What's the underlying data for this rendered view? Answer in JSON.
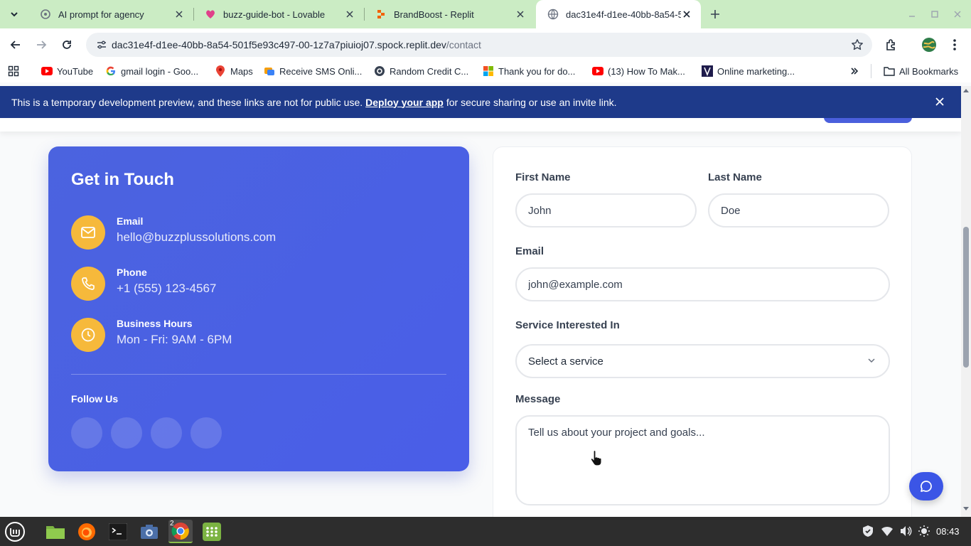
{
  "browser": {
    "tabs": [
      {
        "title": "AI prompt for agency",
        "icon": "openai-icon"
      },
      {
        "title": "buzz-guide-bot - Lovable",
        "icon": "lovable-heart-icon"
      },
      {
        "title": "BrandBoost - Replit",
        "icon": "replit-icon"
      },
      {
        "title": "dac31e4f-d1ee-40bb-8a54-5",
        "icon": "globe-icon",
        "active": true
      }
    ],
    "url_host": "dac31e4f-d1ee-40bb-8a54-501f5e93c497-00-1z7a7piuioj07.spock.replit.dev",
    "url_path": "/contact",
    "bookmarks": [
      {
        "label": "YouTube",
        "icon": "youtube-icon"
      },
      {
        "label": "gmail login - Goo...",
        "icon": "google-icon"
      },
      {
        "label": "Maps",
        "icon": "maps-icon"
      },
      {
        "label": "Receive SMS Onli...",
        "icon": "sms-icon"
      },
      {
        "label": "Random Credit C...",
        "icon": "gear-icon"
      },
      {
        "label": "Thank you for do...",
        "icon": "microsoft-icon"
      },
      {
        "label": "(13) How To Mak...",
        "icon": "youtube-icon"
      },
      {
        "label": "Online marketing...",
        "icon": "vercel-icon"
      }
    ],
    "all_bookmarks": "All Bookmarks"
  },
  "banner": {
    "text_before": "This is a temporary development preview, and these links are not for public use.",
    "link": "Deploy your app",
    "text_after": "for secure sharing or use an invite link."
  },
  "contact_info": {
    "title": "Get in Touch",
    "items": [
      {
        "label": "Email",
        "value": "hello@buzzplussolutions.com",
        "icon": "mail-icon"
      },
      {
        "label": "Phone",
        "value": "+1 (555) 123-4567",
        "icon": "phone-icon"
      },
      {
        "label": "Business Hours",
        "value": "Mon - Fri: 9AM - 6PM",
        "icon": "clock-icon"
      }
    ],
    "follow_label": "Follow Us",
    "social_count": 4
  },
  "form": {
    "first_name": {
      "label": "First Name",
      "placeholder": "John"
    },
    "last_name": {
      "label": "Last Name",
      "placeholder": "Doe"
    },
    "email": {
      "label": "Email",
      "placeholder": "john@example.com"
    },
    "service": {
      "label": "Service Interested In",
      "value": "Select a service"
    },
    "message": {
      "label": "Message",
      "placeholder": "Tell us about your project and goals..."
    }
  },
  "taskbar": {
    "clock": "08:43",
    "chrome_badge": "2"
  },
  "colors": {
    "tab_strip": "#cbecc4",
    "banner": "#1e3a8a",
    "card_blue": "#4a5fe3",
    "icon_circle": "#f6b93b",
    "chat_button": "#3b55e6"
  }
}
